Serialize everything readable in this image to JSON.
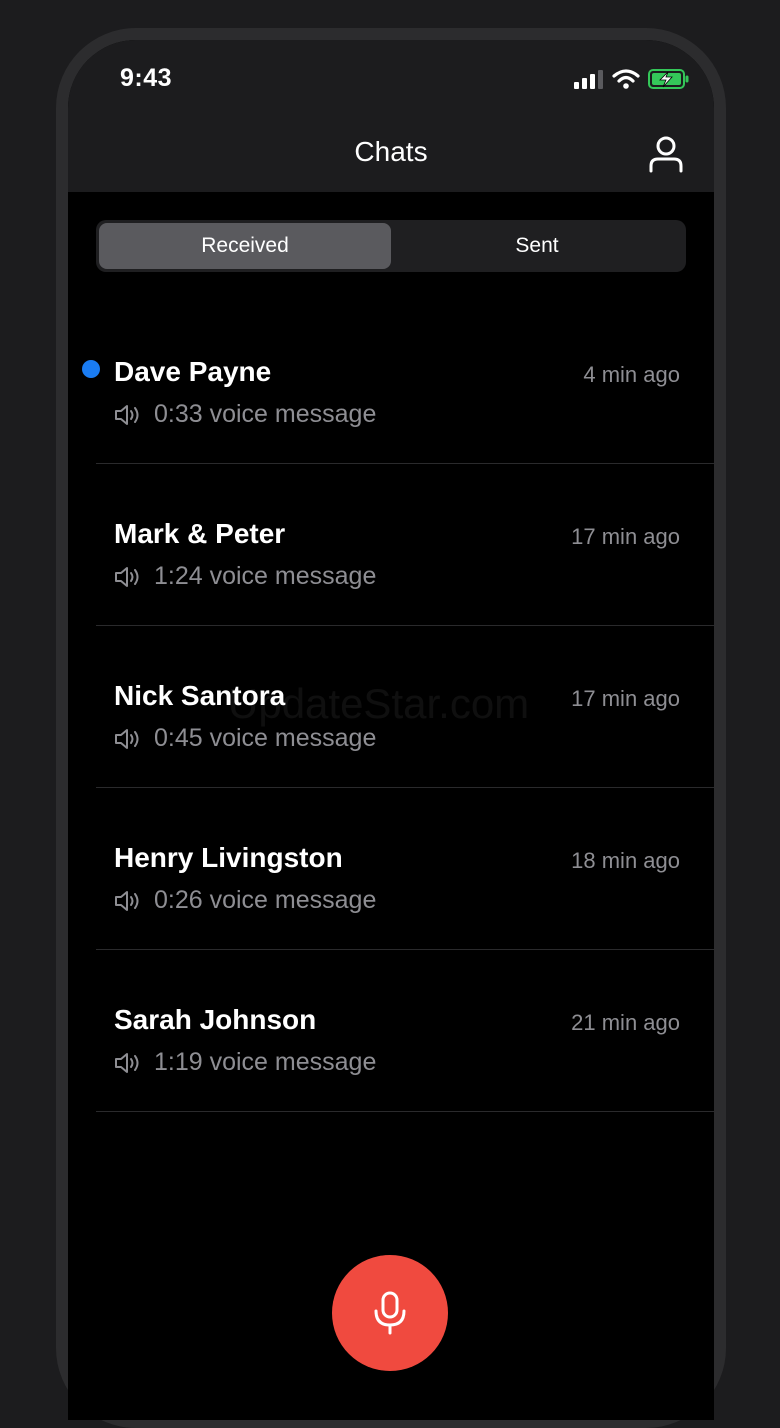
{
  "status_bar": {
    "time": "9:43",
    "signal_icon": "cellular-signal-icon",
    "wifi_icon": "wifi-icon",
    "battery_icon": "battery-charging-icon",
    "battery_color": "#34c759"
  },
  "header": {
    "title": "Chats",
    "profile_icon": "person-icon"
  },
  "tabs": [
    {
      "label": "Received",
      "active": true
    },
    {
      "label": "Sent",
      "active": false
    }
  ],
  "chats": [
    {
      "name": "Dave Payne",
      "time": "4 min ago",
      "message": "0:33 voice message",
      "unread": true
    },
    {
      "name": "Mark & Peter",
      "time": "17 min ago",
      "message": "1:24 voice message",
      "unread": false
    },
    {
      "name": "Nick Santora",
      "time": "17 min ago",
      "message": "0:45 voice message",
      "unread": false
    },
    {
      "name": "Henry Livingston",
      "time": "18 min ago",
      "message": "0:26 voice message",
      "unread": false
    },
    {
      "name": "Sarah Johnson",
      "time": "21 min ago",
      "message": "1:19 voice message",
      "unread": false
    }
  ],
  "watermark": "UpdateStar.com",
  "record_button": {
    "icon": "microphone-icon",
    "color": "#f04a3f"
  },
  "colors": {
    "unread_dot": "#1a7cf2",
    "active_tab": "#5a5a5e"
  }
}
